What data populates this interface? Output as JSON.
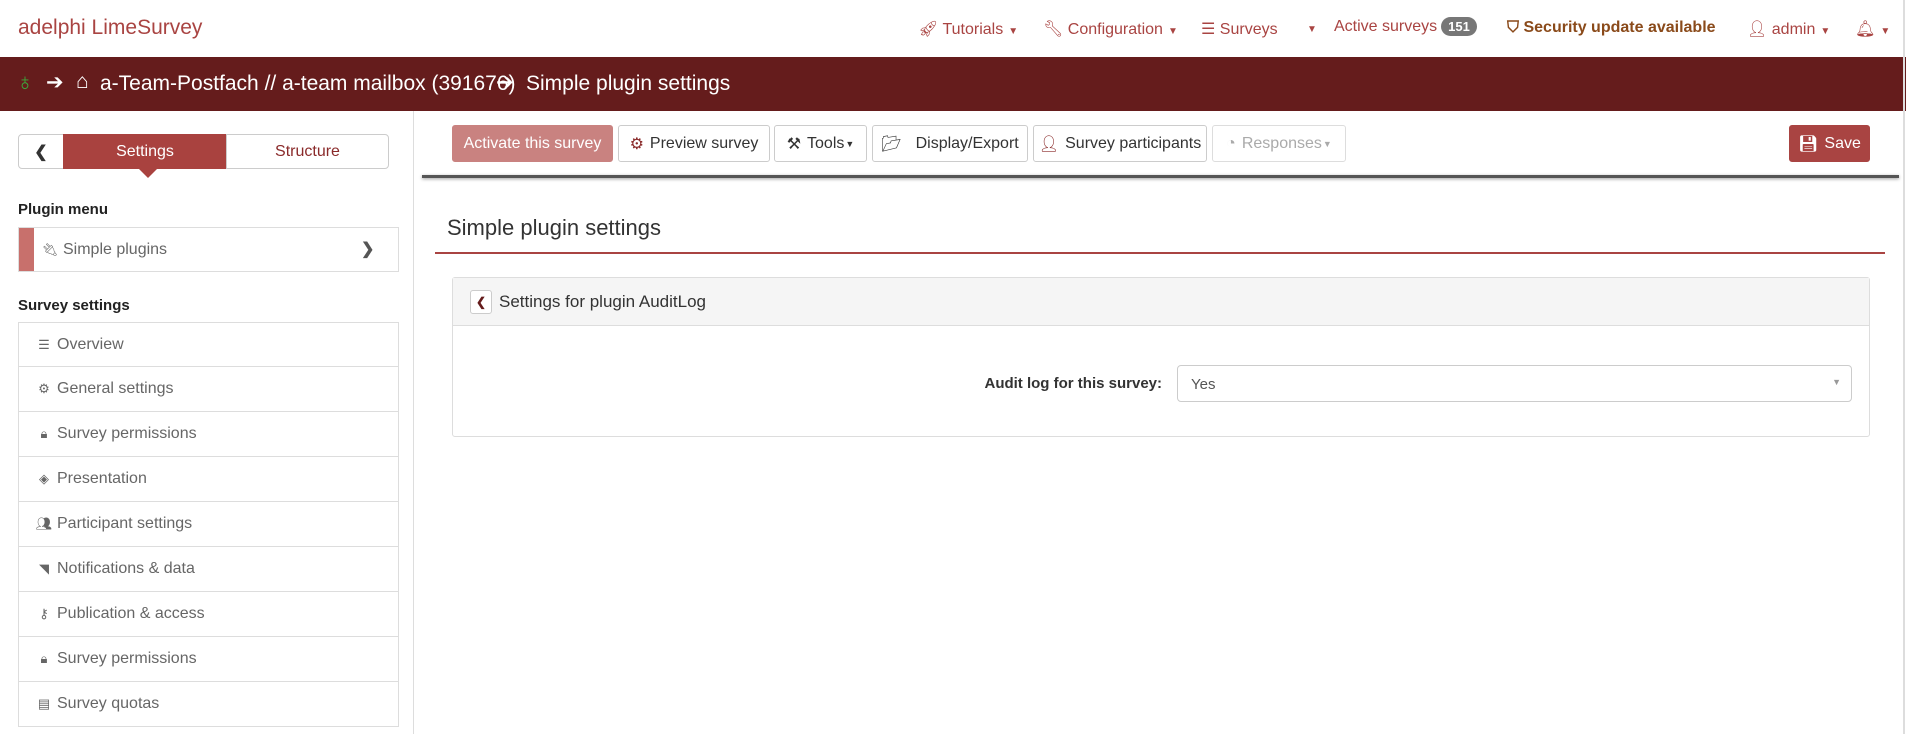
{
  "brand": "adelphi LimeSurvey",
  "topnav": {
    "tutorials": "Tutorials",
    "configuration": "Configuration",
    "surveys": "Surveys",
    "active_surveys": "Active surveys",
    "active_count": "151",
    "security": "Security update available",
    "user": "admin"
  },
  "breadcrumb": {
    "survey": "a-Team-Postfach // a-team mailbox (391676)",
    "page": "Simple plugin settings"
  },
  "sidebar": {
    "tabs": {
      "settings": "Settings",
      "structure": "Structure"
    },
    "plugin_menu_title": "Plugin menu",
    "plugin_item": "Simple plugins",
    "survey_settings_title": "Survey settings",
    "items": [
      {
        "label": "Overview",
        "icon": "list-icon"
      },
      {
        "label": "General settings",
        "icon": "gears-icon"
      },
      {
        "label": "Survey permissions",
        "icon": "lock-icon"
      },
      {
        "label": "Presentation",
        "icon": "eye-slash-icon"
      },
      {
        "label": "Participant settings",
        "icon": "users-icon"
      },
      {
        "label": "Notifications & data",
        "icon": "rss-icon"
      },
      {
        "label": "Publication & access",
        "icon": "key-icon"
      },
      {
        "label": "Survey permissions",
        "icon": "lock-icon"
      },
      {
        "label": "Survey quotas",
        "icon": "tasks-icon"
      }
    ]
  },
  "toolbar": {
    "activate": "Activate this survey",
    "preview": "Preview survey",
    "tools": "Tools",
    "display_export": "Display/Export",
    "participants": "Survey participants",
    "responses": "Responses",
    "save": "Save"
  },
  "main": {
    "title": "Simple plugin settings",
    "panel_title": "Settings for plugin AuditLog",
    "field_label": "Audit log for this survey:",
    "field_value": "Yes"
  },
  "colors": {
    "accent": "#a94442",
    "dark_bar": "#651c1c"
  }
}
